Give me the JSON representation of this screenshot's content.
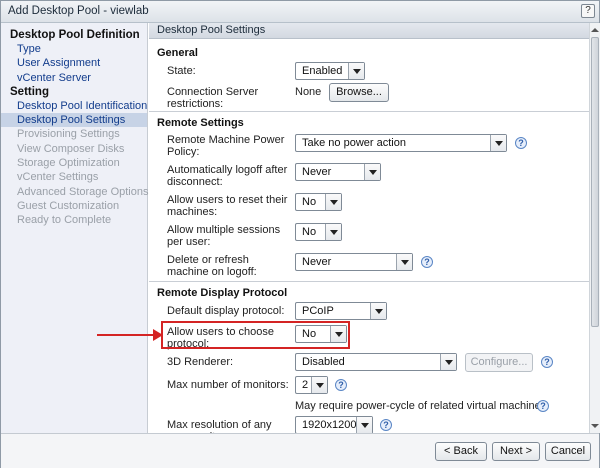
{
  "window": {
    "title": "Add Desktop Pool - viewlab",
    "help": "?"
  },
  "sidebar": {
    "groups": [
      {
        "header": "Desktop Pool Definition",
        "items": [
          {
            "label": "Type",
            "state": "link"
          },
          {
            "label": "User Assignment",
            "state": "link"
          },
          {
            "label": "vCenter Server",
            "state": "link"
          }
        ]
      },
      {
        "header": "Setting",
        "items": [
          {
            "label": "Desktop Pool Identification",
            "state": "link"
          },
          {
            "label": "Desktop Pool Settings",
            "state": "selected"
          },
          {
            "label": "Provisioning Settings",
            "state": "disabled"
          },
          {
            "label": "View Composer Disks",
            "state": "disabled"
          },
          {
            "label": "Storage Optimization",
            "state": "disabled"
          },
          {
            "label": "vCenter Settings",
            "state": "disabled"
          },
          {
            "label": "Advanced Storage Options",
            "state": "disabled"
          },
          {
            "label": "Guest Customization",
            "state": "disabled"
          },
          {
            "label": "Ready to Complete",
            "state": "disabled"
          }
        ]
      }
    ]
  },
  "content": {
    "header": "Desktop Pool Settings",
    "general": {
      "title": "General",
      "state_label": "State:",
      "state_value": "Enabled",
      "conn_label": "Connection Server restrictions:",
      "conn_value": "None",
      "browse": "Browse..."
    },
    "remote": {
      "title": "Remote Settings",
      "power_label": "Remote Machine Power Policy:",
      "power_value": "Take no power action",
      "logoff_label": "Automatically logoff after disconnect:",
      "logoff_value": "Never",
      "reset_label": "Allow users to reset their machines:",
      "reset_value": "No",
      "multi_label": "Allow multiple sessions per user:",
      "multi_value": "No",
      "delete_label": "Delete or refresh machine on logoff:",
      "delete_value": "Never"
    },
    "display": {
      "title": "Remote Display Protocol",
      "default_label": "Default display protocol:",
      "default_value": "PCoIP",
      "choose_label": "Allow users to choose protocol:",
      "choose_value": "No",
      "renderer_label": "3D Renderer:",
      "renderer_value": "Disabled",
      "configure": "Configure...",
      "monitors_label": "Max number of monitors:",
      "monitors_value": "2",
      "note": "May require power-cycle of related virtual machines",
      "resolution_label": "Max resolution of any one monitor:",
      "resolution_value": "1920x1200"
    }
  },
  "footer": {
    "back": "< Back",
    "next": "Next >",
    "cancel": "Cancel"
  },
  "icons": {
    "help": "?"
  },
  "colors": {
    "highlight": "#d42424",
    "selected": "#c7d3e6",
    "link": "#123c8c"
  }
}
